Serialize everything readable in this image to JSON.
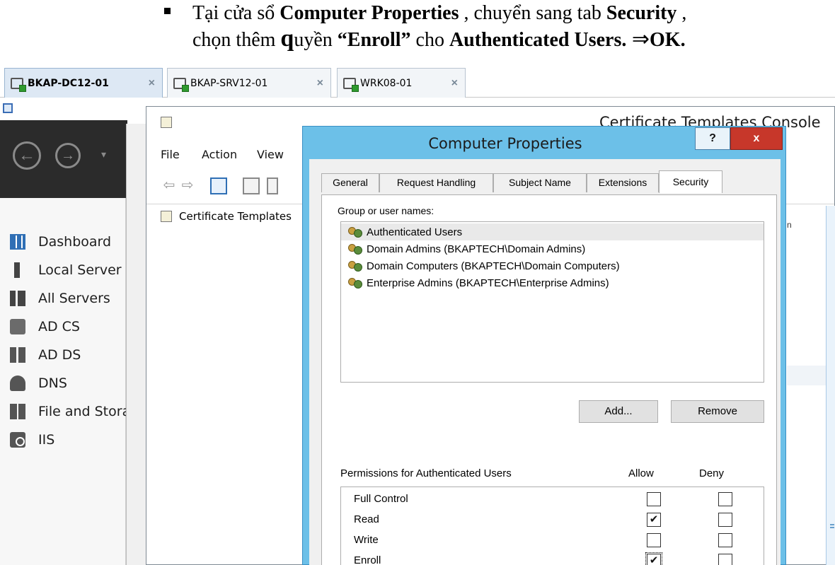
{
  "instruction": {
    "line1_pre": "Tại cửa sổ ",
    "line1_bold1": "Computer Properties",
    "line1_mid": " , chuyển sang tab ",
    "line1_bold2": "Security",
    "line1_post": " ,",
    "line2_pre": "chọn thêm ",
    "line2_q": "q",
    "line2_mid": "uyền ",
    "line2_bold1": "“Enroll”",
    "line2_mid2": " cho ",
    "line2_bold2": "Authenticated Users.",
    "line2_arrow": " ⇒",
    "line2_ok": "OK."
  },
  "vm_tabs": [
    {
      "name": "BKAP-DC12-01",
      "active": true
    },
    {
      "name": "BKAP-SRV12-01",
      "active": false
    },
    {
      "name": "WRK08-01",
      "active": false
    }
  ],
  "vm_tab_close": "×",
  "server_manager": {
    "nav_back": "←",
    "nav_forward": "→",
    "nav_dropdown": "▾",
    "sidebar": [
      "Dashboard",
      "Local Server",
      "All Servers",
      "AD CS",
      "AD DS",
      "DNS",
      "File and Storage Services",
      "IIS"
    ],
    "icons": [
      "dashboard-icon",
      "local-server-icon",
      "all-servers-icon",
      "ad-cs-icon",
      "ad-ds-icon",
      "dns-icon",
      "file-storage-icon",
      "iis-icon"
    ]
  },
  "mmc": {
    "title": "Certificate Templates Console",
    "menu": [
      "File",
      "Action",
      "View"
    ],
    "tree_root": "Certificate Templates",
    "right_mark": "n"
  },
  "dialog": {
    "title": "Computer Properties",
    "help_label": "?",
    "close_label": "x",
    "tabs": [
      "General",
      "Request Handling",
      "Subject Name",
      "Extensions",
      "Security"
    ],
    "active_tab": "Security",
    "group_label": "Group or user names:",
    "users": [
      "Authenticated Users",
      "Domain Admins (BKAPTECH\\Domain Admins)",
      "Domain Computers (BKAPTECH\\Domain Computers)",
      "Enterprise Admins (BKAPTECH\\Enterprise Admins)"
    ],
    "selected_user": "Authenticated Users",
    "add_button": "Add...",
    "remove_button": "Remove",
    "permissions_label": "Permissions for Authenticated Users",
    "allow_header": "Allow",
    "deny_header": "Deny",
    "permissions": [
      {
        "name": "Full Control",
        "allow": false,
        "deny": false
      },
      {
        "name": "Read",
        "allow": true,
        "deny": false
      },
      {
        "name": "Write",
        "allow": false,
        "deny": false
      },
      {
        "name": "Enroll",
        "allow": true,
        "deny": false
      }
    ],
    "check_mark": "✔"
  }
}
